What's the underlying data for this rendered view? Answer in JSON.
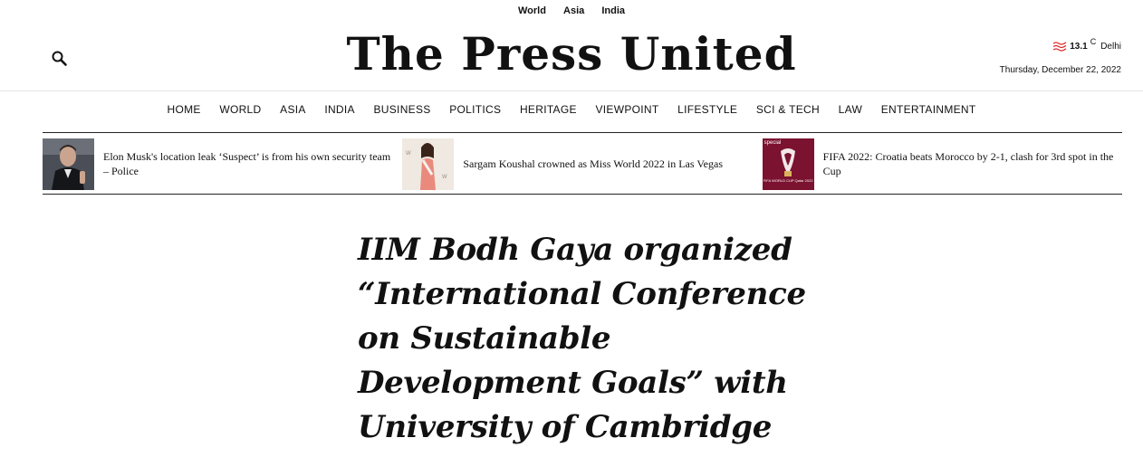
{
  "top_links": [
    "World",
    "Asia",
    "India"
  ],
  "logo": "The Press United",
  "weather": {
    "temperature": "13.1",
    "unit": "C",
    "city": "Delhi",
    "icon": "wave-icon",
    "icon_color": "#e03030"
  },
  "date": "Thursday, December 22, 2022",
  "nav": [
    "HOME",
    "WORLD",
    "ASIA",
    "INDIA",
    "BUSINESS",
    "POLITICS",
    "HERITAGE",
    "VIEWPOINT",
    "LIFESTYLE",
    "SCI & TECH",
    "LAW",
    "ENTERTAINMENT"
  ],
  "ticker": [
    {
      "title": "Elon Musk's location leak ‘Suspect’ is from his own security team – Police"
    },
    {
      "title": "Sargam Koushal crowned as Miss World 2022 in Las Vegas"
    },
    {
      "title": "FIFA 2022: Croatia beats Morocco by 2-1, clash for 3rd spot in the Cup",
      "thumb_text": "special",
      "thumb_caption": "FIFA WORLD CUP Qatar 2022"
    }
  ],
  "headline": "IIM Bodh Gaya organized “International Conference on Sustainable Development Goals” with University of Cambridge"
}
